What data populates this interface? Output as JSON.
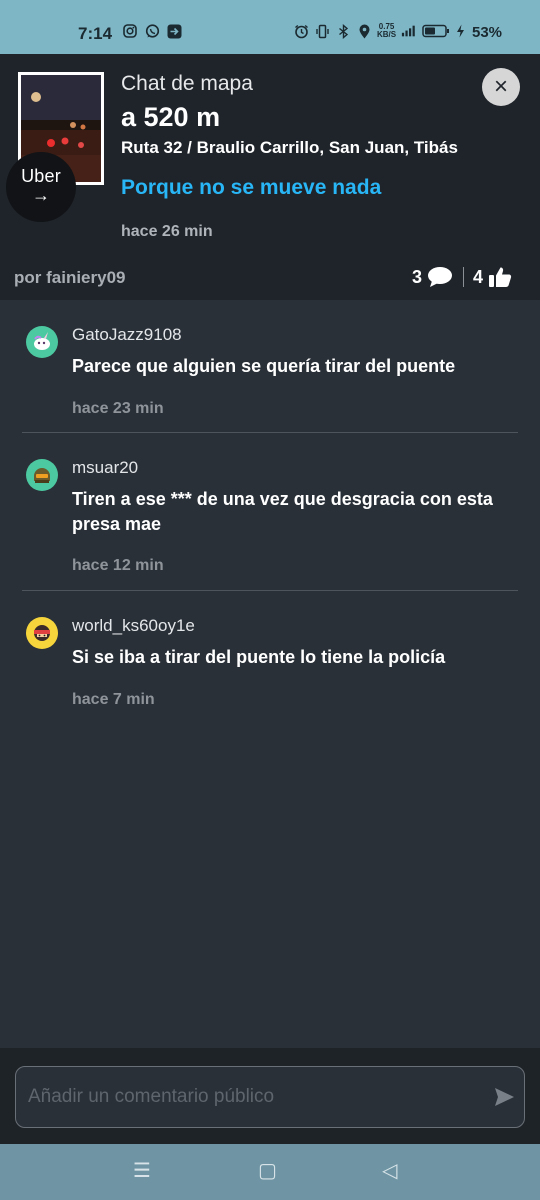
{
  "status_bar": {
    "time": "7:14",
    "left_icons": [
      "instagram-icon",
      "whatsapp-icon",
      "app-arrow-icon"
    ],
    "right_icons": [
      "alarm-icon",
      "vibrate-icon",
      "bluetooth-icon",
      "location-icon"
    ],
    "speed_value": "0.75",
    "speed_unit": "KB/S",
    "battery_percent": "53%"
  },
  "header": {
    "title": "Chat de mapa",
    "distance": "a 520 m",
    "location": "Ruta 32 / Braulio Carrillo, San Juan, Tibás",
    "message": "Porque no se mueve nada",
    "time_ago": "hace 26 min",
    "author": "por fainiery09",
    "comment_count": "3",
    "like_count": "4",
    "badge_label": "Uber",
    "badge_arrow": "→",
    "close_icon": "×"
  },
  "comments": [
    {
      "username": "GatoJazz9108",
      "text": "Parece que alguien se quería tirar del puente",
      "time_ago": "hace 23 min",
      "avatar_color": "#4cc9a0",
      "avatar_icon": "unicorn-icon"
    },
    {
      "username": "msuar20",
      "text": "Tiren a ese *** de una vez que desgracia con esta presa mae",
      "time_ago": "hace 12 min",
      "avatar_color": "#4cc9a0",
      "avatar_icon": "helmet-icon"
    },
    {
      "username": "world_ks60oy1e",
      "text": "Si se iba a tirar del puente lo tiene la policía",
      "time_ago": "hace 7 min",
      "avatar_color": "#f5d53b",
      "avatar_icon": "ninja-icon"
    }
  ],
  "input": {
    "placeholder": "Añadir un comentario público"
  },
  "nav_bar": {
    "menu_glyph": "☰",
    "home_glyph": "▢",
    "back_glyph": "◁"
  },
  "colors": {
    "accent_blue": "#29b6f6",
    "header_bg": "#1f242a",
    "list_bg": "#2a3038",
    "status_bar_bg": "#7eb6c6"
  }
}
